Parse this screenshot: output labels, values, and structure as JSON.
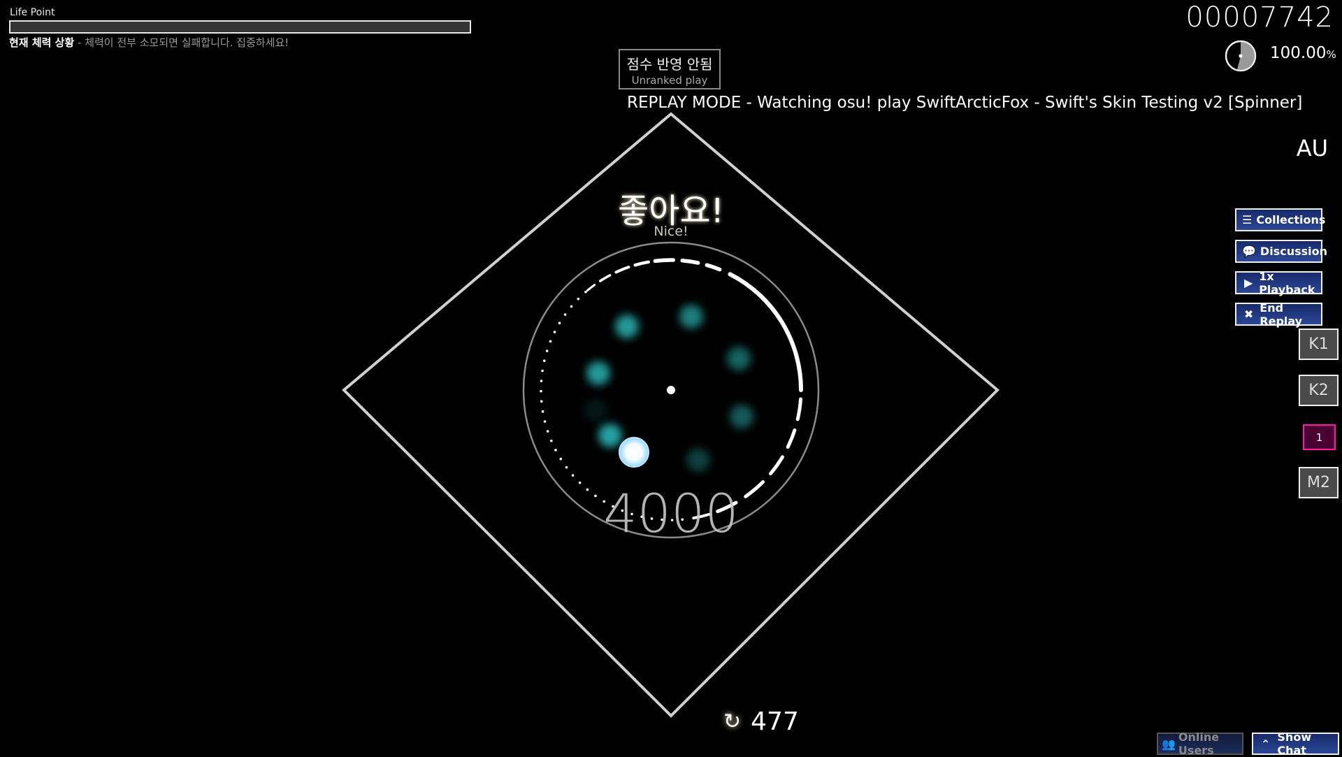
{
  "hud": {
    "life_label": "Life Point",
    "life_fraction": 0.0,
    "life_desc_bold": "현재 체력 상황",
    "life_desc_sep": " - ",
    "life_desc_text": "체력이 전부 소모되면 실패합니다. 집중하세요!",
    "score": "00007742",
    "accuracy_value": "100.00",
    "accuracy_unit": "%",
    "song_progress": 0.54
  },
  "unranked": {
    "korean": "점수 반영 안됨",
    "english": "Unranked play"
  },
  "replay_title": "REPLAY MODE - Watching osu! play SwiftArcticFox - Swift's Skin Testing v2 [Spinner]",
  "mod": "AU",
  "side_buttons": [
    {
      "label": "Collections",
      "icon": "list-icon"
    },
    {
      "label": "Discussion",
      "icon": "chat-bubbles-icon"
    },
    {
      "label": "1x Playback",
      "icon": "play-icon"
    },
    {
      "label": "End Replay",
      "icon": "close-icon"
    }
  ],
  "keys": [
    {
      "label": "K1",
      "active": false
    },
    {
      "label": "K2",
      "active": false
    },
    {
      "label": "1",
      "active": true
    },
    {
      "label": "M2",
      "active": false
    }
  ],
  "judgement": {
    "korean": "좋아요!",
    "english": "Nice!"
  },
  "spinner": {
    "bonus_score": "4000",
    "spin_count": "477"
  },
  "bottom": {
    "online_users": "Online Users",
    "show_chat": "Show Chat"
  },
  "colors": {
    "accent_blue": "#2b4796",
    "key_active": "#ff1aa8",
    "spinner_dots": "#2ab3b3"
  }
}
